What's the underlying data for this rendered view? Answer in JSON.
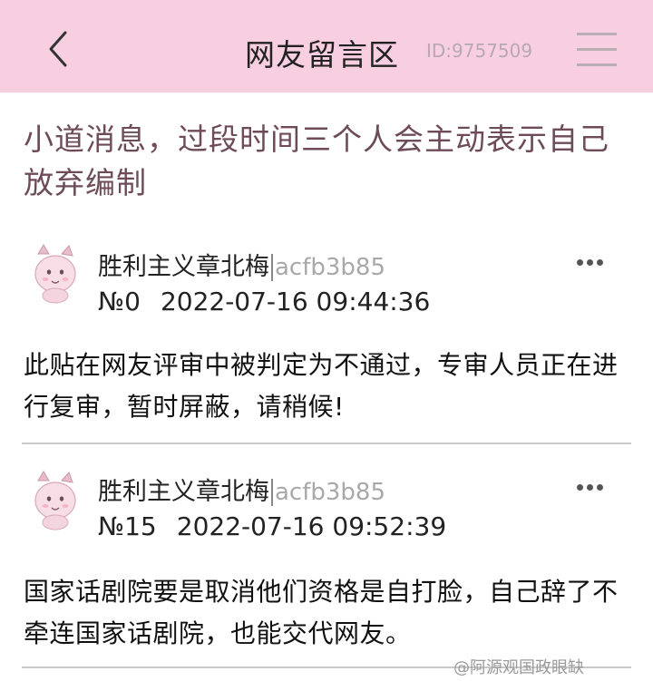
{
  "header": {
    "title": "网友留言区",
    "id_text": "ID:9757509"
  },
  "thread": {
    "title": "小道消息，过段时间三个人会主动表示自己放弃编制"
  },
  "comments": [
    {
      "username": "胜利主义章北梅",
      "user_hash": "acfb3b85",
      "number": "№0",
      "timestamp": "2022-07-16 09:44:36",
      "body": "此贴在网友评审中被判定为不通过，专审人员正在进行复审，暂时屏蔽，请稍候!"
    },
    {
      "username": "胜利主义章北梅",
      "user_hash": "acfb3b85",
      "number": "№15",
      "timestamp": "2022-07-16 09:52:39",
      "body": "国家话剧院要是取消他们资格是自打脸，自己辞了不牵连国家话剧院，也能交代网友。"
    }
  ],
  "icons": {
    "back": "chevron-left-icon",
    "menu": "hamburger-menu-icon",
    "more": "more-dots-icon",
    "avatar": "pink-creature-avatar"
  },
  "colors": {
    "header_bg": "#f8cfe1",
    "thread_title": "#6e4b58",
    "user_hash": "#a9a9ab",
    "divider": "#c9c9c9"
  },
  "watermark": "@阿源观国政眼缺"
}
